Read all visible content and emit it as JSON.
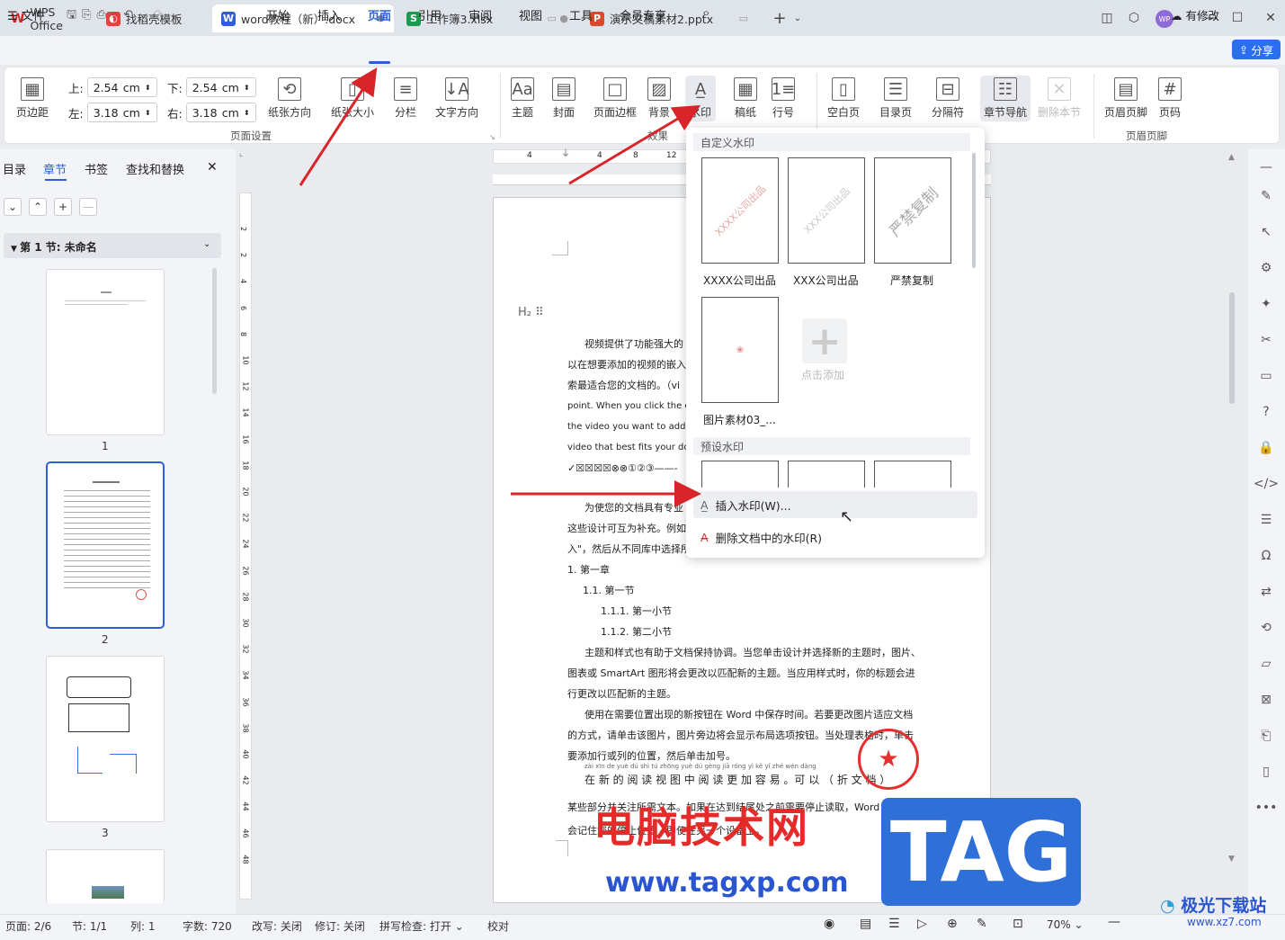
{
  "tabs": [
    {
      "label": "WPS Office",
      "icon": "wps-logo-icon"
    },
    {
      "label": "找稻壳模板",
      "icon": "docer-icon"
    },
    {
      "label": "word教程（新）.docx",
      "icon": "writer-icon"
    },
    {
      "label": "工作簿3.xlsx",
      "icon": "sheet-icon"
    },
    {
      "label": "演示文稿素材2.pptx",
      "icon": "presentation-icon"
    }
  ],
  "tab_icon_letters": {
    "writer": "W",
    "sheet": "S",
    "presentation": "P"
  },
  "user_avatar": "WP",
  "menu": {
    "file": "文件",
    "items": [
      "开始",
      "插入",
      "页面",
      "引用",
      "审阅",
      "视图",
      "工具",
      "会员专享"
    ],
    "active": "页面",
    "modified": "有修改",
    "share": "分享"
  },
  "ribbon": {
    "margins": {
      "button": "页边距",
      "top_label": "上:",
      "top": "2.54",
      "bottom_label": "下:",
      "bottom": "2.54",
      "left_label": "左:",
      "left": "3.18",
      "right_label": "右:",
      "right": "3.18",
      "unit": "cm"
    },
    "buttons_page_setup": [
      "纸张方向",
      "纸张大小",
      "分栏",
      "文字方向"
    ],
    "group_page_setup": "页面设置",
    "buttons_effect": [
      "主题",
      "封面",
      "页面边框",
      "背景",
      "水印",
      "稿纸",
      "行号"
    ],
    "group_effect": "效果",
    "buttons_page": [
      "空白页",
      "目录页",
      "分隔符",
      "章节导航",
      "删除本节"
    ],
    "buttons_header": [
      "页眉页脚",
      "页码"
    ],
    "group_header": "页眉页脚"
  },
  "left_panel": {
    "tabs": [
      "目录",
      "章节",
      "书签",
      "查找和替换"
    ],
    "active_tab": "章节",
    "section_title": "第 1 节: 未命名",
    "thumb_labels": [
      "1",
      "2",
      "3"
    ]
  },
  "ruler": {
    "horizontal": [
      "4",
      "4",
      "8",
      "12"
    ],
    "vertical": [
      "2",
      "2",
      "4",
      "6",
      "8",
      "10",
      "12",
      "14",
      "16",
      "18",
      "20",
      "22",
      "24",
      "26",
      "28",
      "30",
      "32",
      "34",
      "36",
      "38",
      "40",
      "42",
      "44",
      "46",
      "48"
    ]
  },
  "document": {
    "heading_marker": "H₂",
    "lines": [
      "视频提供了功能强大的",
      "以在想要添加的视频的嵌入",
      "索最适合您的文档的。（vi",
      "point. When you click the o",
      "the video you want to add.",
      "video that best fits your doc",
      "✓☒☒☒☒⊗⊗①②③——-",
      "",
      "为使您的文档具有专业",
      "这些设计可互为补充。例如",
      "入\"，然后从不同库中选择所"
    ],
    "list": [
      "1.   第一章",
      "1.1.  第一节",
      "1.1.1.   第一小节",
      "1.1.2.   第二小节"
    ],
    "paragraphs": [
      "主题和样式也有助于文档保持协调。当您单击设计并选择新的主题时，图片、",
      "图表或 SmartArt 图形将会更改以匹配新的主题。当应用样式时，你的标题会进",
      "行更改以匹配新的主题。",
      "使用在需要位置出现的新按钮在 Word 中保存时间。若要更改图片适应文档",
      "的方式，请单击该图片，图片旁边将会显示布局选项按钮。当处理表格时，单击",
      "要添加行或列的位置，然后单击加号。"
    ],
    "pinyin_line": "zài  xīn  de  yuè  dú  shì  tú  zhōng  yuè  dú  gèng  jiā  róng  yì     kě  yǐ        zhé     wén  dàng",
    "ruby_line": "在 新 的 阅 读 视 图 中 阅 读 更 加 容 易 。可 以 （ 折 文 档 ）",
    "tail_lines": [
      "某些部分并关注所需文本。如果在达到结尾处之前需要停止读取，Word",
      "会记住您的停止位置 - 即使在另一个设备上。"
    ]
  },
  "dropdown": {
    "custom_header": "自定义水印",
    "custom_items": [
      "XXXX公司出品",
      "XXX公司出品",
      "严禁复制",
      "图片素材03_..."
    ],
    "card_text": [
      "XXXX公司出品",
      "XXX公司出品",
      "严禁复制"
    ],
    "add_label": "点击添加",
    "preset_header": "预设水印",
    "insert_item": "插入水印(W)...",
    "delete_item": "删除文档中的水印(R)"
  },
  "status": {
    "page": "页面: 2/6",
    "section": "节: 1/1",
    "column": "列: 1",
    "words": "字数: 720",
    "revise_mode": "改写: 关闭",
    "track": "修订: 关闭",
    "spell": "拼写检查: 打开",
    "proof": "校对",
    "zoom": "70%"
  },
  "overlay": {
    "cn_text": "电脑技术网",
    "url": "www.tagxp.com",
    "tag": "TAG",
    "site": "极光下载站",
    "site_url": "www.xz7.com"
  },
  "colors": {
    "accent": "#2b5fd9",
    "arrow": "#d9252a"
  }
}
